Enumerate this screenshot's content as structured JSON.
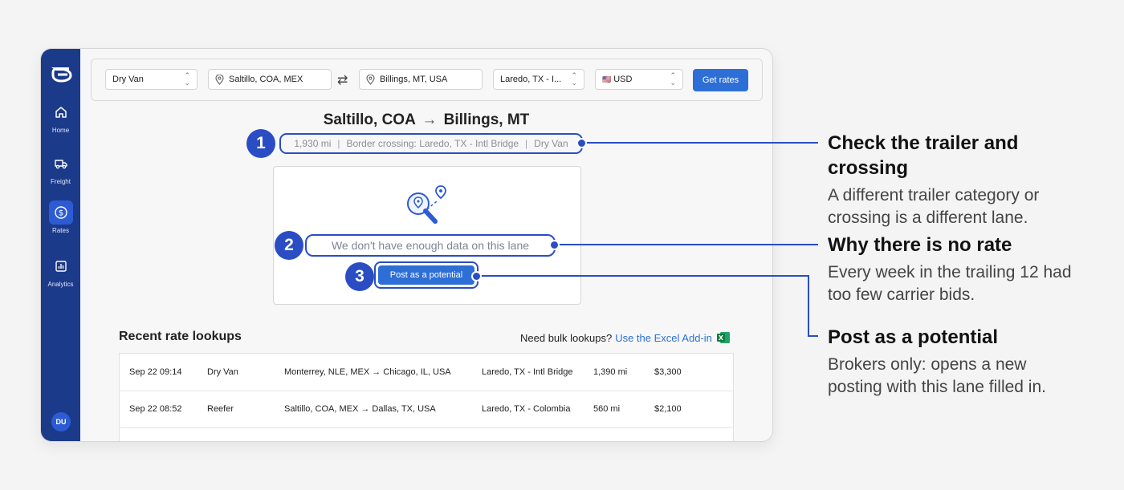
{
  "sidebar": {
    "items": [
      {
        "label": "Home",
        "icon": "home-icon"
      },
      {
        "label": "Freight",
        "icon": "truck-icon"
      },
      {
        "label": "Rates",
        "icon": "dollar-icon"
      },
      {
        "label": "Analytics",
        "icon": "chart-icon"
      }
    ],
    "active": "Rates",
    "avatar": "DU"
  },
  "toolbar": {
    "equipment": "Dry Van",
    "origin": "Saltillo, COA, MEX",
    "destination": "Billings, MT, USA",
    "crossing": "Laredo, TX - I...",
    "currency": "USD",
    "currency_flag": "🇺🇸",
    "get_rates_label": "Get rates"
  },
  "route": {
    "origin": "Saltillo, COA",
    "arrow": "→",
    "destination": "Billings, MT",
    "distance": "1,930 mi",
    "crossing": "Border crossing: Laredo, TX - Intl Bridge",
    "equipment": "Dry Van"
  },
  "result": {
    "no_data_message": "We don't have enough data on this lane",
    "post_button_label": "Post as a potential"
  },
  "recent": {
    "title": "Recent rate lookups",
    "bulk_prompt": "Need bulk lookups?",
    "bulk_link": "Use the Excel Add-in",
    "rows": [
      {
        "time": "Sep 22 09:14",
        "equipment": "Dry Van",
        "lane": "Monterrey, NLE, MEX → Chicago, IL, USA",
        "crossing": "Laredo, TX - Intl Bridge",
        "distance": "1,390 mi",
        "rate": "$3,300"
      },
      {
        "time": "Sep 22 08:52",
        "equipment": "Reefer",
        "lane": "Saltillo, COA, MEX → Dallas, TX, USA",
        "crossing": "Laredo, TX - Colombia",
        "distance": "560 mi",
        "rate": "$2,100"
      }
    ]
  },
  "callouts": [
    {
      "number": "1",
      "title_line1": "Check the trailer and",
      "title_line2": "crossing",
      "desc_line1": "A different trailer category or",
      "desc_line2": "crossing is a different lane."
    },
    {
      "number": "2",
      "title": "Why there is no rate",
      "desc_line1": "Every week in the trailing 12 had",
      "desc_line2": "too few carrier bids."
    },
    {
      "number": "3",
      "title": "Post as a potential",
      "desc_line1": "Brokers only: opens a new",
      "desc_line2": "posting with this lane filled in."
    }
  ],
  "colors": {
    "sidebar": "#1c3a8a",
    "accent": "#2d6fd6",
    "annotation": "#2a4dc4"
  }
}
